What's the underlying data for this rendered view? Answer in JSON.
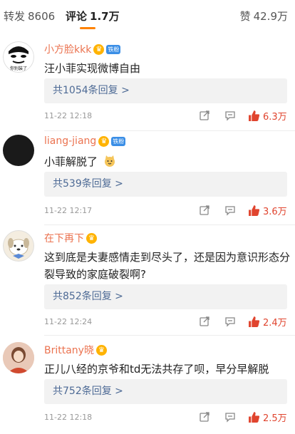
{
  "tabs": {
    "repost_label": "转发",
    "repost_count": "8606",
    "comment_label": "评论",
    "comment_count": "1.7万",
    "like_label": "赞",
    "like_count": "42.9万"
  },
  "colors": {
    "accent": "#ff8200",
    "username": "#eb7350",
    "link": "#4d6a95",
    "like_active": "#e0442e"
  },
  "comments": [
    {
      "user": "小方脸kkk",
      "text": "汪小菲实现微博自由",
      "replies": "共1054条回复 >",
      "date": "11-22 12:18",
      "likes": "6.3万",
      "avatar_caption": "你别装了"
    },
    {
      "user": "liang-jiang",
      "text": "小菲解脱了",
      "replies": "共539条回复 >",
      "date": "11-22 12:17",
      "likes": "3.6万"
    },
    {
      "user": "在下再下",
      "text": "这到底是夫妻感情走到尽头了，还是因为意识形态分裂导致的家庭破裂啊?",
      "replies": "共852条回复 >",
      "date": "11-22 12:24",
      "likes": "2.4万"
    },
    {
      "user": "Brittany晓",
      "text": "正儿八经的京爷和td无法共存了呗，早分早解脱",
      "replies": "共752条回复 >",
      "date": "11-22 12:18",
      "likes": "2.5万"
    }
  ],
  "badges": {
    "fan_label": "铁粉"
  }
}
